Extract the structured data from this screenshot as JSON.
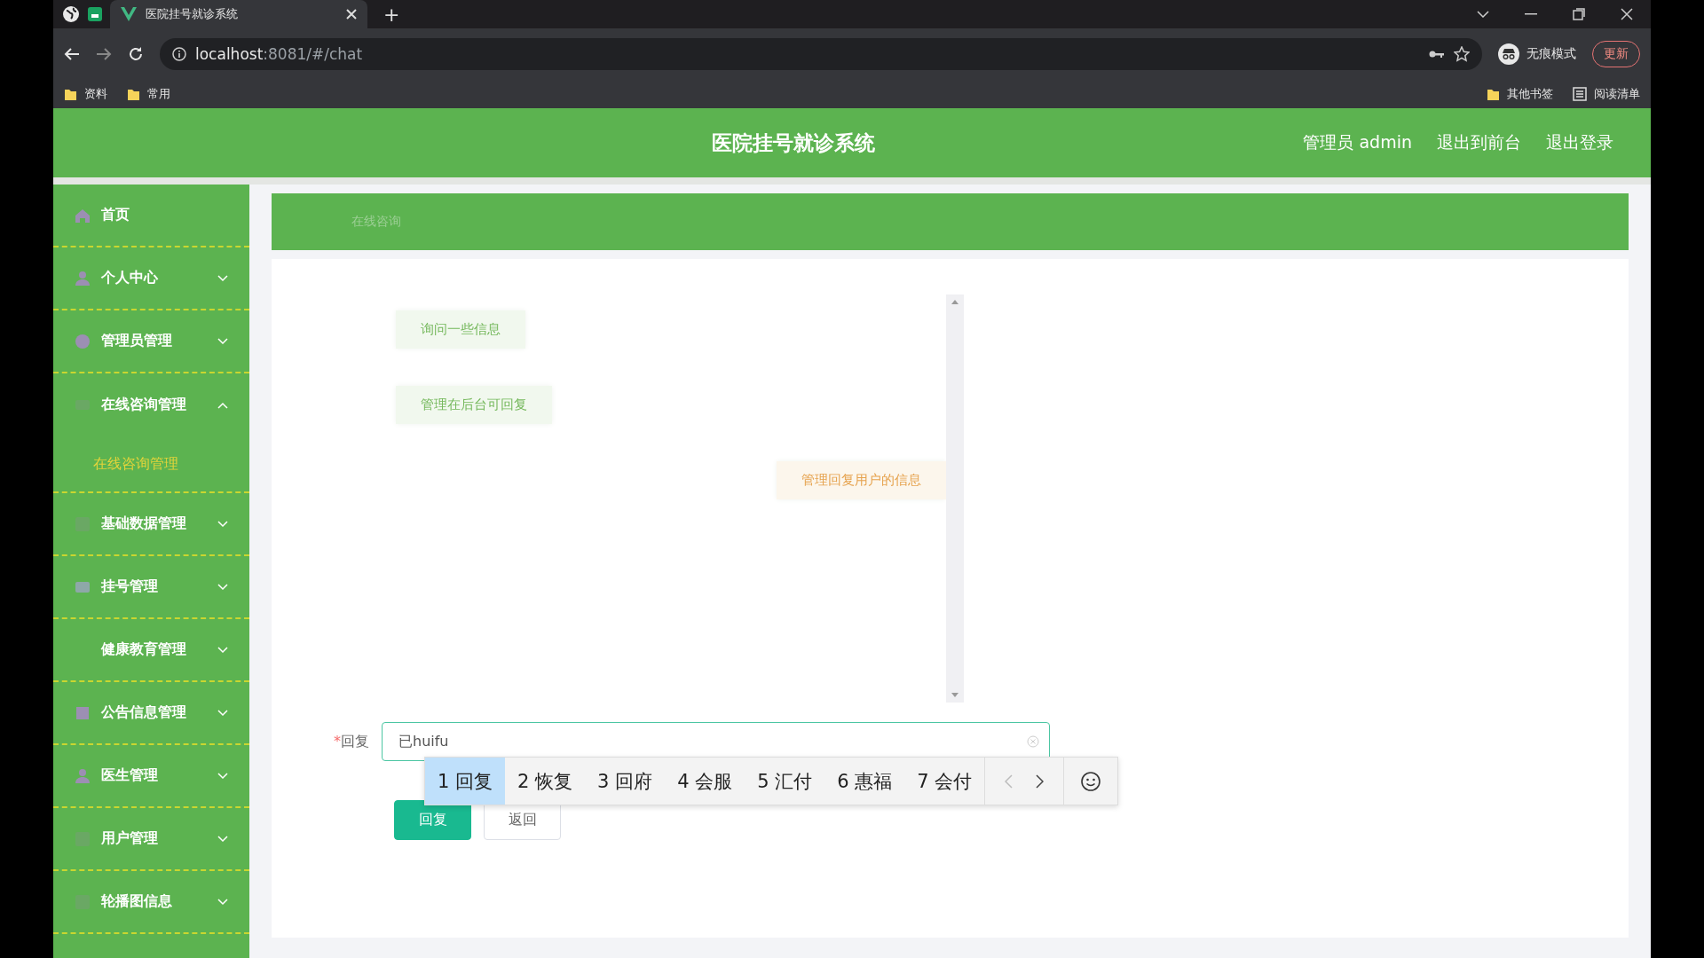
{
  "browser": {
    "tabs": [
      {
        "title": "医院挂号就诊系统",
        "selected": true
      }
    ],
    "new_tab": "+",
    "address": {
      "host": "localhost",
      "path": ":8081/#/chat"
    },
    "profile": "无痕模式",
    "update_button": "更新",
    "bookmarks": [
      "资料",
      "常用"
    ],
    "other_bookmarks": "其他书签",
    "reading_list": "阅读清单"
  },
  "header": {
    "title": "医院挂号就诊系统",
    "links": [
      "管理员 admin",
      "退出到前台",
      "退出登录"
    ]
  },
  "sidebar": {
    "items": [
      {
        "label": "首页"
      },
      {
        "label": "个人中心",
        "expanded": false
      },
      {
        "label": "管理员管理",
        "expanded": false
      },
      {
        "label": "在线咨询管理",
        "expanded": true,
        "children": [
          {
            "label": "在线咨询管理",
            "selected": true
          }
        ]
      },
      {
        "label": "基础数据管理",
        "expanded": false
      },
      {
        "label": "挂号管理",
        "expanded": false
      },
      {
        "label": "健康教育管理",
        "expanded": false
      },
      {
        "label": "公告信息管理",
        "expanded": false
      },
      {
        "label": "医生管理",
        "expanded": false
      },
      {
        "label": "用户管理",
        "expanded": false
      },
      {
        "label": "轮播图信息",
        "expanded": false
      }
    ]
  },
  "breadcrumb": "在线咨询",
  "chat": {
    "messages": [
      {
        "kind": "user",
        "text": "询问一些信息"
      },
      {
        "kind": "user",
        "text": "管理在后台可回复"
      },
      {
        "kind": "admin",
        "text": "管理回复用户的信息"
      }
    ]
  },
  "form": {
    "label": "回复",
    "required_mark": "*",
    "value": "已huifu",
    "buttons": [
      {
        "kind": "primary",
        "label": "回复"
      },
      {
        "kind": "plain",
        "label": "返回"
      }
    ]
  },
  "ime": {
    "candidates": [
      {
        "index": "1",
        "text": "回复",
        "selected": true
      },
      {
        "index": "2",
        "text": "恢复",
        "selected": false
      },
      {
        "index": "3",
        "text": "回府",
        "selected": false
      },
      {
        "index": "4",
        "text": "会服",
        "selected": false
      },
      {
        "index": "5",
        "text": "汇付",
        "selected": false
      },
      {
        "index": "6",
        "text": "惠福",
        "selected": false
      },
      {
        "index": "7",
        "text": "会付",
        "selected": false
      }
    ]
  }
}
